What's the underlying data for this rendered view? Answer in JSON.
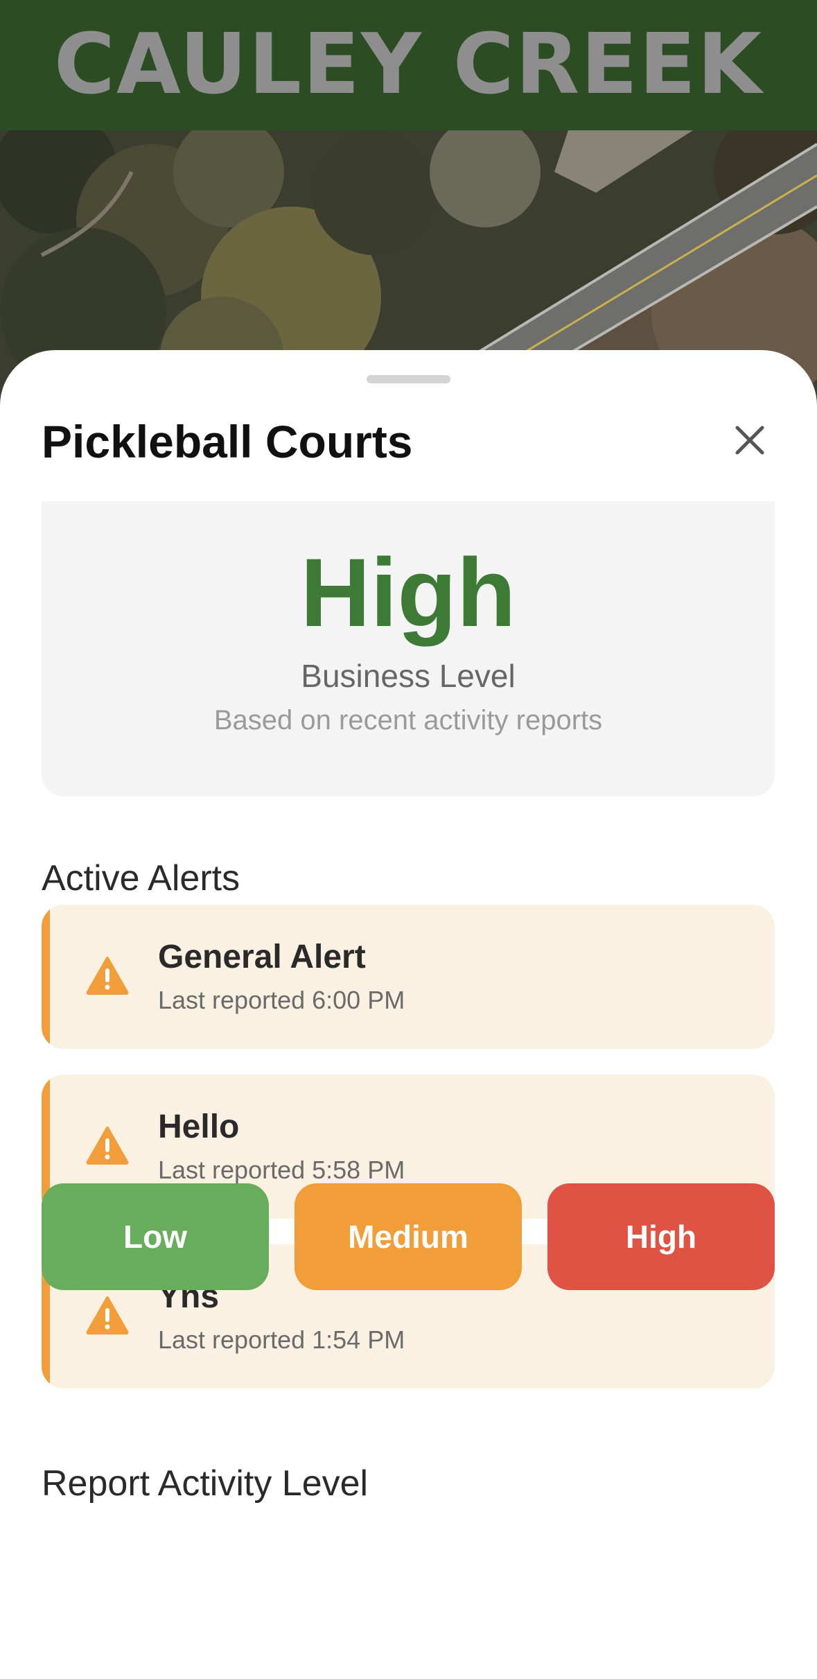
{
  "header": {
    "title": "CAULEY CREEK"
  },
  "sheet": {
    "title": "Pickleball Courts",
    "close_icon": "close-icon"
  },
  "business_level": {
    "value": "High",
    "label": "Business Level",
    "subtitle": "Based on recent activity reports",
    "value_color": "#3d7a36"
  },
  "alerts_section": {
    "title": "Active Alerts",
    "icon": "warning-icon",
    "accent_color": "#f19e3a",
    "items": [
      {
        "title": "General Alert",
        "time": "Last reported 6:00 PM"
      },
      {
        "title": "Hello",
        "time": "Last reported 5:58 PM"
      },
      {
        "title": "Yns",
        "time": "Last reported 1:54 PM"
      }
    ]
  },
  "report_section": {
    "title": "Report Activity Level",
    "buttons": [
      {
        "label": "Low",
        "color": "#67ad5b"
      },
      {
        "label": "Medium",
        "color": "#f19e3a"
      },
      {
        "label": "High",
        "color": "#e05243"
      }
    ]
  },
  "colors": {
    "header_bg": "#2c4c24",
    "sheet_bg": "#ffffff",
    "card_bg": "#f4f4f4",
    "alert_bg": "#fbf1e2"
  }
}
